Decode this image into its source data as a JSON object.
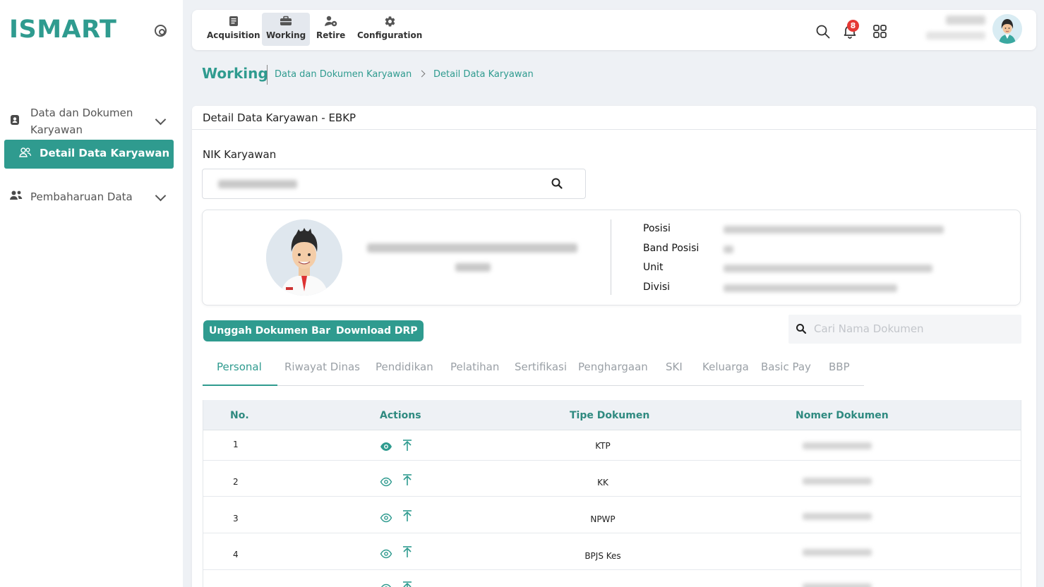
{
  "brand": {
    "logo": "ISMART",
    "accent": "#2f9b8f"
  },
  "sidebar": {
    "groups": [
      {
        "label": "Data dan Dokumen Karyawan",
        "icon": "document-user-icon"
      },
      {
        "label": "Pembaharuan Data",
        "icon": "users-icon"
      }
    ],
    "active_item": {
      "label": "Detail Data Karyawan",
      "icon": "users-outline-icon"
    }
  },
  "topbar": {
    "modules": [
      {
        "label": "Acquisition",
        "icon": "clipboard-icon"
      },
      {
        "label": "Working",
        "icon": "briefcase-icon",
        "active": true
      },
      {
        "label": "Retire",
        "icon": "user-retire-icon"
      },
      {
        "label": "Configuration",
        "icon": "gear-icon"
      }
    ],
    "notification_count": "8"
  },
  "breadcrumb": {
    "root": "Working",
    "items": [
      "Data dan Dokumen Karyawan",
      "Detail Data Karyawan"
    ]
  },
  "card": {
    "title": "Detail Data Karyawan - EBKP",
    "nik_label": "NIK Karyawan"
  },
  "profile": {
    "fields": [
      "Posisi",
      "Band Posisi",
      "Unit",
      "Divisi"
    ]
  },
  "actions": {
    "upload": "Unggah Dokumen Baru",
    "download": "Download DRP",
    "search_placeholder": "Cari Nama Dokumen"
  },
  "tabs": [
    "Personal",
    "Riwayat Dinas",
    "Pendidikan",
    "Pelatihan",
    "Sertifikasi",
    "Penghargaan",
    "SKI",
    "Keluarga",
    "Basic Pay",
    "BBP"
  ],
  "active_tab": "Personal",
  "table": {
    "headers": [
      "No.",
      "Actions",
      "Tipe Dokumen",
      "Nomer Dokumen"
    ],
    "rows": [
      {
        "no": "1",
        "type": "KTP"
      },
      {
        "no": "2",
        "type": "KK"
      },
      {
        "no": "3",
        "type": "NPWP"
      },
      {
        "no": "4",
        "type": "BPJS Kes"
      }
    ]
  }
}
